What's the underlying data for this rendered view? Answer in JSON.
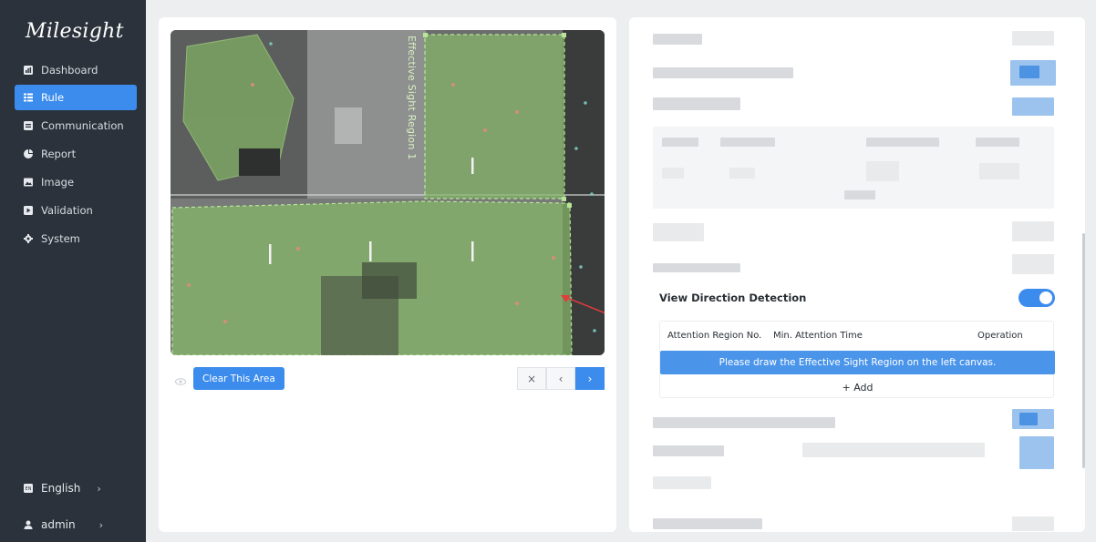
{
  "sidebar": {
    "logo": "Milesight",
    "items": [
      {
        "label": "Dashboard",
        "icon": "dashboard-icon"
      },
      {
        "label": "Rule",
        "icon": "rule-icon",
        "active": true
      },
      {
        "label": "Communication",
        "icon": "communication-icon"
      },
      {
        "label": "Report",
        "icon": "report-icon"
      },
      {
        "label": "Image",
        "icon": "image-icon"
      },
      {
        "label": "Validation",
        "icon": "validation-icon"
      },
      {
        "label": "System",
        "icon": "system-icon"
      }
    ],
    "language": {
      "label": "English",
      "icon": "language-icon",
      "chevron": "›"
    },
    "user": {
      "label": "admin",
      "icon": "user-icon",
      "chevron": "›"
    }
  },
  "canvas": {
    "region_label": "Effective Sight Region 1",
    "clear_button": "Clear This Area",
    "nav": {
      "close": "×",
      "prev": "‹",
      "next": "›"
    }
  },
  "view_direction": {
    "label": "View Direction Detection",
    "enabled": true,
    "columns": [
      "Attention Region No.",
      "Min. Attention Time",
      "Operation"
    ],
    "notice": "Please draw the Effective Sight Region on the left canvas.",
    "add_label": "+ Add"
  },
  "colors": {
    "accent": "#3c8ced",
    "sidebar_bg": "#2b323b",
    "region_fill": "#8fc36a",
    "arrow": "#e23b3b"
  }
}
